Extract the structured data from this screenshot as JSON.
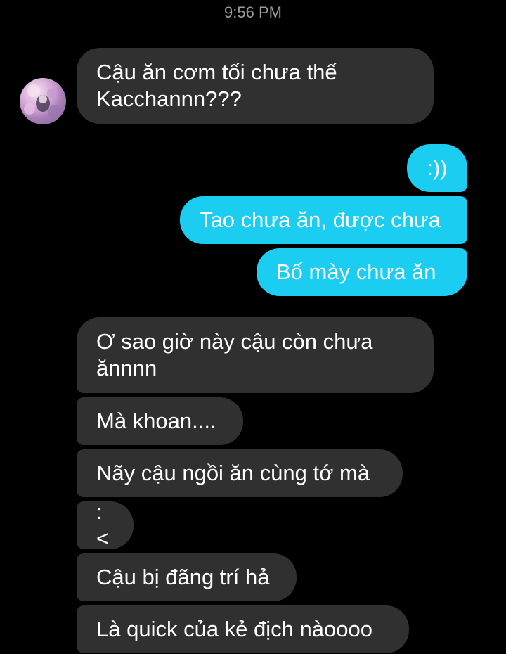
{
  "status": {
    "time": "9:56 PM"
  },
  "contact": {
    "avatar_icon": "avatar-icon"
  },
  "colors": {
    "background": "#000000",
    "incoming_bubble": "#303030",
    "outgoing_bubble": "#1ccdf2",
    "text": "#ffffff"
  },
  "messages": [
    {
      "direction": "incoming",
      "text": "Cậu ăn cơm tối chưa thế\nKacchannn???"
    },
    {
      "direction": "outgoing",
      "text": ":))"
    },
    {
      "direction": "outgoing",
      "text": "Tao chưa ăn, được chưa"
    },
    {
      "direction": "outgoing",
      "text": "Bố mày chưa ăn"
    },
    {
      "direction": "incoming",
      "text": "Ơ sao giờ này cậu còn chưa\nănnnn"
    },
    {
      "direction": "incoming",
      "text": "Mà khoan...."
    },
    {
      "direction": "incoming",
      "text": "Nãy cậu ngồi ăn cùng tớ mà"
    },
    {
      "direction": "incoming",
      "text": ":<"
    },
    {
      "direction": "incoming",
      "text": "Cậu bị đãng trí hả"
    },
    {
      "direction": "incoming",
      "text": "Là quick của kẻ địch nàoooo"
    }
  ]
}
